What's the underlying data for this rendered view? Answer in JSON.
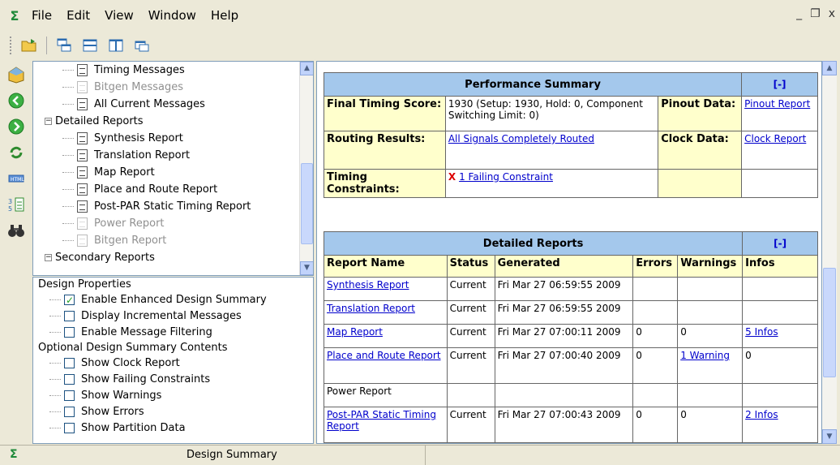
{
  "menubar": {
    "items": [
      "File",
      "Edit",
      "View",
      "Window",
      "Help"
    ],
    "window_controls": [
      "_",
      "❐",
      "x"
    ]
  },
  "tree": {
    "rows": [
      {
        "label": "Timing Messages",
        "indent": 3,
        "dim": false,
        "doc": true
      },
      {
        "label": "Bitgen Messages",
        "indent": 3,
        "dim": true,
        "doc": true
      },
      {
        "label": "All Current Messages",
        "indent": 3,
        "dim": false,
        "doc": true
      },
      {
        "label": "Detailed Reports",
        "indent": 1,
        "dim": false,
        "doc": false,
        "toggle": "−"
      },
      {
        "label": "Synthesis Report",
        "indent": 3,
        "dim": false,
        "doc": true
      },
      {
        "label": "Translation Report",
        "indent": 3,
        "dim": false,
        "doc": true
      },
      {
        "label": "Map Report",
        "indent": 3,
        "dim": false,
        "doc": true
      },
      {
        "label": "Place and Route Report",
        "indent": 3,
        "dim": false,
        "doc": true
      },
      {
        "label": "Post-PAR Static Timing Report",
        "indent": 3,
        "dim": false,
        "doc": true
      },
      {
        "label": "Power Report",
        "indent": 3,
        "dim": true,
        "doc": true
      },
      {
        "label": "Bitgen Report",
        "indent": 3,
        "dim": true,
        "doc": true
      },
      {
        "label": "Secondary Reports",
        "indent": 1,
        "dim": false,
        "doc": false,
        "toggle": "−"
      }
    ]
  },
  "properties": {
    "design_properties_label": "Design Properties",
    "design_properties": [
      {
        "label": "Enable Enhanced Design Summary",
        "checked": true
      },
      {
        "label": "Display Incremental Messages",
        "checked": false
      },
      {
        "label": "Enable Message Filtering",
        "checked": false
      }
    ],
    "optional_label": "Optional Design Summary Contents",
    "optional": [
      {
        "label": "Show Clock Report",
        "checked": false
      },
      {
        "label": "Show Failing Constraints",
        "checked": false
      },
      {
        "label": "Show Warnings",
        "checked": false
      },
      {
        "label": "Show Errors",
        "checked": false
      },
      {
        "label": "Show Partition Data",
        "checked": false
      }
    ]
  },
  "performance": {
    "title": "Performance Summary",
    "collapse": "[-]",
    "final_timing_label": "Final Timing Score:",
    "final_timing_value": "1930 (Setup: 1930, Hold: 0, Component Switching Limit: 0)",
    "pinout_label": "Pinout Data:",
    "pinout_link": "Pinout Report",
    "routing_label": "Routing Results:",
    "routing_link": "All Signals Completely Routed",
    "clock_label": "Clock Data:",
    "clock_link": "Clock Report",
    "timing_constraints_label": "Timing Constraints:",
    "timing_constraints_mark": "X",
    "timing_constraints_link": "1 Failing Constraint"
  },
  "detailed": {
    "title": "Detailed Reports",
    "collapse": "[-]",
    "headers": [
      "Report Name",
      "Status",
      "Generated",
      "Errors",
      "Warnings",
      "Infos"
    ],
    "rows": [
      {
        "name": "Synthesis Report",
        "link": true,
        "status": "Current",
        "generated": "Fri Mar 27 06:59:55 2009",
        "errors": "",
        "warnings": "",
        "warnings_link": false,
        "infos": "",
        "infos_link": false
      },
      {
        "name": "Translation Report",
        "link": true,
        "status": "Current",
        "generated": "Fri Mar 27 06:59:55 2009",
        "errors": "",
        "warnings": "",
        "warnings_link": false,
        "infos": "",
        "infos_link": false
      },
      {
        "name": "Map Report",
        "link": true,
        "status": "Current",
        "generated": "Fri Mar 27 07:00:11 2009",
        "errors": "0",
        "warnings": "0",
        "warnings_link": false,
        "infos": "5 Infos",
        "infos_link": true
      },
      {
        "name": "Place and Route Report",
        "link": true,
        "status": "Current",
        "generated": "Fri Mar 27 07:00:40 2009",
        "errors": "0",
        "warnings": "1 Warning",
        "warnings_link": true,
        "infos": "0",
        "infos_link": false
      },
      {
        "name": "Power Report",
        "link": false,
        "status": "",
        "generated": "",
        "errors": "",
        "warnings": "",
        "warnings_link": false,
        "infos": "",
        "infos_link": false
      },
      {
        "name": "Post-PAR Static Timing Report",
        "link": true,
        "status": "Current",
        "generated": "Fri Mar 27 07:00:43 2009",
        "errors": "0",
        "warnings": "0",
        "warnings_link": false,
        "infos": "2 Infos",
        "infos_link": true
      }
    ]
  },
  "statusbar": {
    "tab_label": "Design Summary"
  }
}
